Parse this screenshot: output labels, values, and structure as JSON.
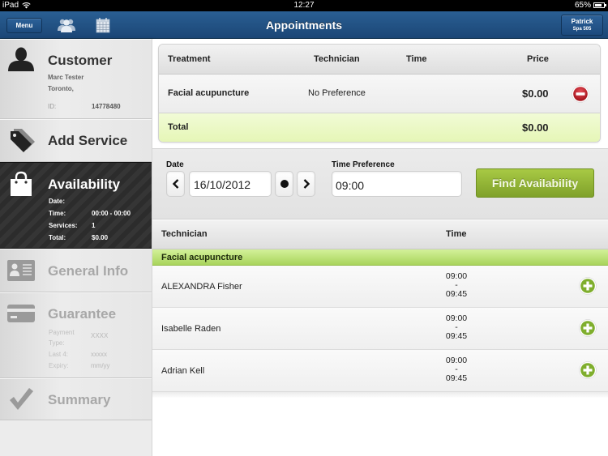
{
  "status_bar": {
    "device": "iPad",
    "wifi_icon": "wifi-icon",
    "time": "12:27",
    "battery_percent": "65%",
    "battery_level": 0.65
  },
  "navbar": {
    "title": "Appointments",
    "menu_label": "Menu",
    "icons": [
      "clients-icon",
      "calendar-icon"
    ],
    "user_name": "Patrick",
    "user_location": "Spa 505"
  },
  "sidebar": {
    "customer": {
      "title": "Customer",
      "name": "Marc Tester",
      "city": "Toronto,",
      "id_label": "ID:",
      "id_value": "14778480",
      "icon": "person-icon"
    },
    "add_service": {
      "title": "Add Service",
      "icon": "tag-icon"
    },
    "availability": {
      "title": "Availability",
      "icon": "shopping-bag-icon",
      "fields": [
        {
          "key": "Date:",
          "value": ""
        },
        {
          "key": "Time:",
          "value": "00:00 - 00:00"
        },
        {
          "key": "Services:",
          "value": "1"
        },
        {
          "key": "Total:",
          "value": "$0.00"
        }
      ]
    },
    "general_info": {
      "title": "General Info",
      "icon": "id-card-icon"
    },
    "guarantee": {
      "title": "Guarantee",
      "icon": "credit-card-icon",
      "fields": [
        {
          "key": "Payment Type:",
          "value": "XXXX"
        },
        {
          "key": "Last 4:",
          "value": "xxxxx"
        },
        {
          "key": "Expiry:",
          "value": "mm/yy"
        }
      ]
    },
    "summary": {
      "title": "Summary",
      "icon": "checkmark-icon"
    }
  },
  "cart": {
    "headers": {
      "treatment": "Treatment",
      "technician": "Technician",
      "time": "Time",
      "price": "Price"
    },
    "rows": [
      {
        "treatment": "Facial acupuncture",
        "technician": "No Preference",
        "time": "",
        "price": "$0.00"
      }
    ],
    "total_label": "Total",
    "total_value": "$0.00"
  },
  "search": {
    "date_label": "Date",
    "date_value": "16/10/2012",
    "time_label": "Time Preference",
    "time_value": "09:00",
    "find_button": "Find Availability"
  },
  "availability": {
    "headers": {
      "technician": "Technician",
      "time": "Time"
    },
    "group": "Facial acupuncture",
    "rows": [
      {
        "technician": "ALEXANDRA Fisher",
        "start": "09:00",
        "sep": "-",
        "end": "09:45"
      },
      {
        "technician": "Isabelle Raden",
        "start": "09:00",
        "sep": "-",
        "end": "09:45"
      },
      {
        "technician": "Adrian Kell",
        "start": "09:00",
        "sep": "-",
        "end": "09:45"
      }
    ]
  },
  "colors": {
    "nav_blue": "#1f4f82",
    "accent_green": "#8cb032",
    "remove_red": "#c0202a",
    "active_dark": "#2c2c2c"
  }
}
